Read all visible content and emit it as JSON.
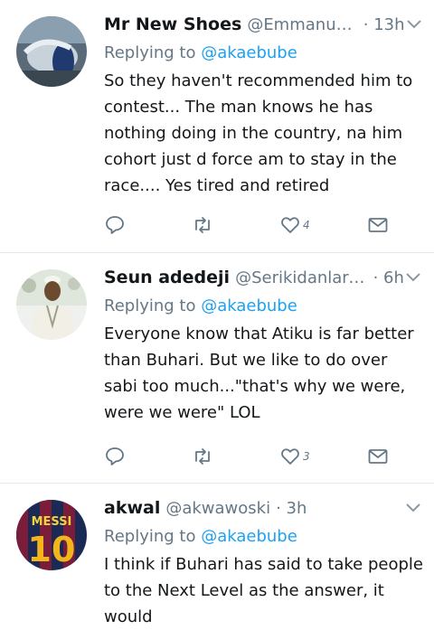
{
  "tweets": [
    {
      "name": "Mr New Shoes",
      "handle": "@Emmanuel...",
      "time": "· 13h",
      "replying_prefix": "Replying to ",
      "replying_to": "@akaebube",
      "text": "So they haven't recommended him to contest... The man knows he has nothing doing in the country, na him cohort just d force am to stay in the race.... Yes tired and retired",
      "likes": "4"
    },
    {
      "name": "Seun adedeji",
      "handle": "@Serikidanlardie",
      "time": "· 6h",
      "replying_prefix": "Replying to ",
      "replying_to": "@akaebube",
      "text": "Everyone know that Atiku is far better than Buhari. But we like to do over sabi too much...\"that's why we were, were we were\" LOL",
      "likes": "3"
    },
    {
      "name": "akwal",
      "handle": "@akwawoski",
      "time": "· 3h",
      "replying_prefix": "Replying to ",
      "replying_to": "@akaebube",
      "text": "I think if Buhari has said to take people to the Next Level as the answer, it would",
      "avatar_text": "MESSI",
      "avatar_number": "10"
    }
  ],
  "colors": {
    "accent": "#1da1f2",
    "secondary_text": "#657786",
    "icon": "#657786",
    "divider": "#e1e8ed"
  }
}
